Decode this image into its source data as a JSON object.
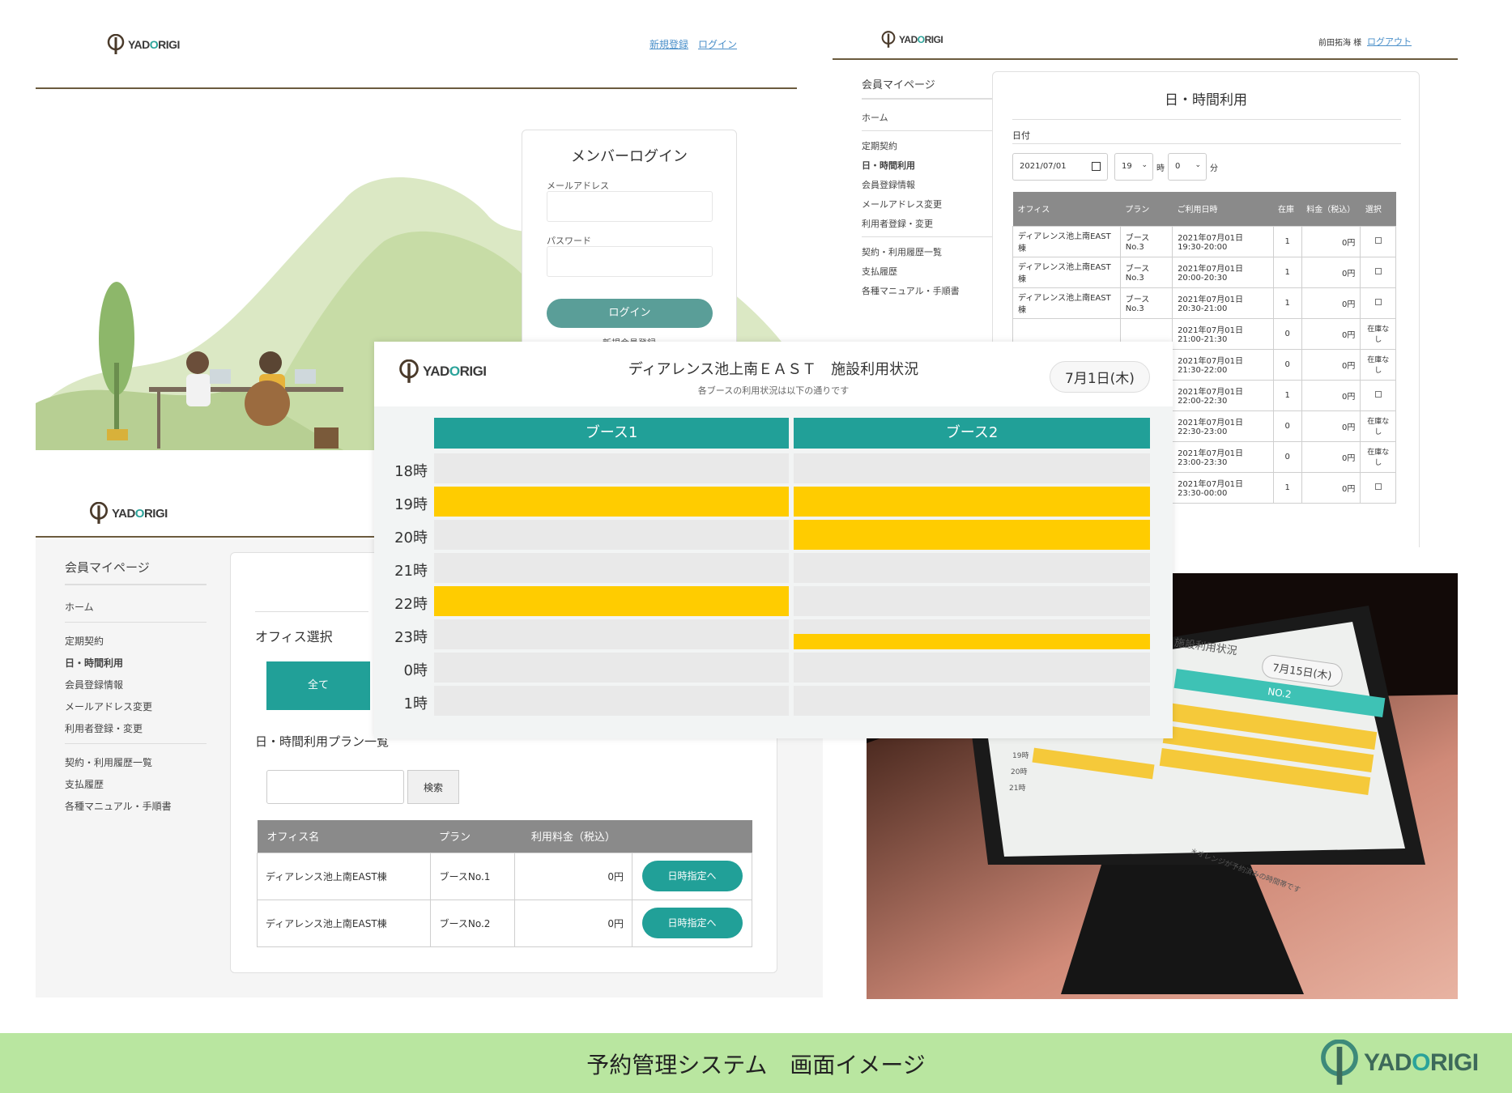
{
  "brand": {
    "logo_text_pre": "YAD",
    "logo_text_o": "O",
    "logo_text_post": "RIGI",
    "teal": "#21a098",
    "yellow": "#ffcc00",
    "footer_green": "#b9e6a0"
  },
  "login": {
    "nav_signup": "新規登録",
    "nav_login": "ログイン",
    "title": "メンバーログイン",
    "email_label": "メールアドレス",
    "password_label": "パスワード",
    "login_button": "ログイン",
    "signup_link": "新規会員登録"
  },
  "hourly": {
    "user_name": "前田拓海 様",
    "logout": "ログアウト",
    "sidebar_title": "会員マイページ",
    "sidebar_items": [
      "ホーム",
      "定期契約",
      "日・時間利用",
      "会員登録情報",
      "メールアドレス変更",
      "利用者登録・変更",
      "契約・利用履歴一覧",
      "支払履歴",
      "各種マニュアル・手順書"
    ],
    "title": "日・時間利用",
    "date_label": "日付",
    "date_value": "2021/07/01",
    "hour_value": "19",
    "hour_unit": "時",
    "minute_value": "0",
    "minute_unit": "分",
    "columns": [
      "オフィス",
      "プラン",
      "ご利用日時",
      "在庫",
      "料金（税込）",
      "選択"
    ],
    "rows": [
      {
        "office": "ディアレンス池上南EAST棟",
        "plan": "ブースNo.3",
        "time": "2021年07月01日 19:30-20:00",
        "stock": "1",
        "price": "0円",
        "select": ""
      },
      {
        "office": "ディアレンス池上南EAST棟",
        "plan": "ブースNo.3",
        "time": "2021年07月01日 20:00-20:30",
        "stock": "1",
        "price": "0円",
        "select": ""
      },
      {
        "office": "ディアレンス池上南EAST棟",
        "plan": "ブースNo.3",
        "time": "2021年07月01日 20:30-21:00",
        "stock": "1",
        "price": "0円",
        "select": ""
      },
      {
        "office": "",
        "plan": "",
        "time": "2021年07月01日 21:00-21:30",
        "stock": "0",
        "price": "0円",
        "select": "在庫なし"
      },
      {
        "office": "",
        "plan": "",
        "time": "2021年07月01日 21:30-22:00",
        "stock": "0",
        "price": "0円",
        "select": "在庫なし"
      },
      {
        "office": "",
        "plan": "",
        "time": "2021年07月01日 22:00-22:30",
        "stock": "1",
        "price": "0円",
        "select": ""
      },
      {
        "office": "",
        "plan": "",
        "time": "2021年07月01日 22:30-23:00",
        "stock": "0",
        "price": "0円",
        "select": "在庫なし"
      },
      {
        "office": "",
        "plan": "",
        "time": "2021年07月01日 23:00-23:30",
        "stock": "0",
        "price": "0円",
        "select": "在庫なし"
      },
      {
        "office": "",
        "plan": "",
        "time": "2021年07月01日 23:30-00:00",
        "stock": "1",
        "price": "0円",
        "select": ""
      }
    ]
  },
  "mypage": {
    "sidebar_title": "会員マイページ",
    "sidebar_items": [
      "ホーム",
      "定期契約",
      "日・時間利用",
      "会員登録情報",
      "メールアドレス変更",
      "利用者登録・変更",
      "契約・利用履歴一覧",
      "支払履歴",
      "各種マニュアル・手順書"
    ],
    "office_select": "オフィス選択",
    "all_button": "全て",
    "plan_list_title": "日・時間利用プラン一覧",
    "search_button": "検索",
    "columns": [
      "オフィス名",
      "プラン",
      "利用料金（税込）"
    ],
    "rows": [
      {
        "office": "ディアレンス池上南EAST棟",
        "plan": "ブースNo.1",
        "price": "0円",
        "action": "日時指定へ"
      },
      {
        "office": "ディアレンス池上南EAST棟",
        "plan": "ブースNo.2",
        "price": "0円",
        "action": "日時指定へ"
      }
    ]
  },
  "status": {
    "title": "ディアレンス池上南ＥＡＳＴ　施設利用状況",
    "subtitle": "各ブースの利用状況は以下の通りです",
    "date_badge": "7月1日(木)",
    "booths": [
      "ブース1",
      "ブース2"
    ],
    "hours": [
      "18時",
      "19時",
      "20時",
      "21時",
      "22時",
      "23時",
      "0時",
      "1時"
    ],
    "occupancy": {
      "booth1": [
        0,
        1,
        0,
        0,
        1,
        0,
        0,
        0
      ],
      "booth2": [
        0,
        1,
        1,
        0,
        0,
        0.5,
        0,
        0
      ]
    }
  },
  "photo": {
    "screen_title": "施設利用状況",
    "date_badge": "7月15日(木)",
    "booth_label": "NO.2",
    "hours": [
      "19時",
      "20時",
      "21時"
    ],
    "note": "＊オレンジが予約済みの時間帯です"
  },
  "footer": {
    "caption": "予約管理システム　画面イメージ"
  }
}
